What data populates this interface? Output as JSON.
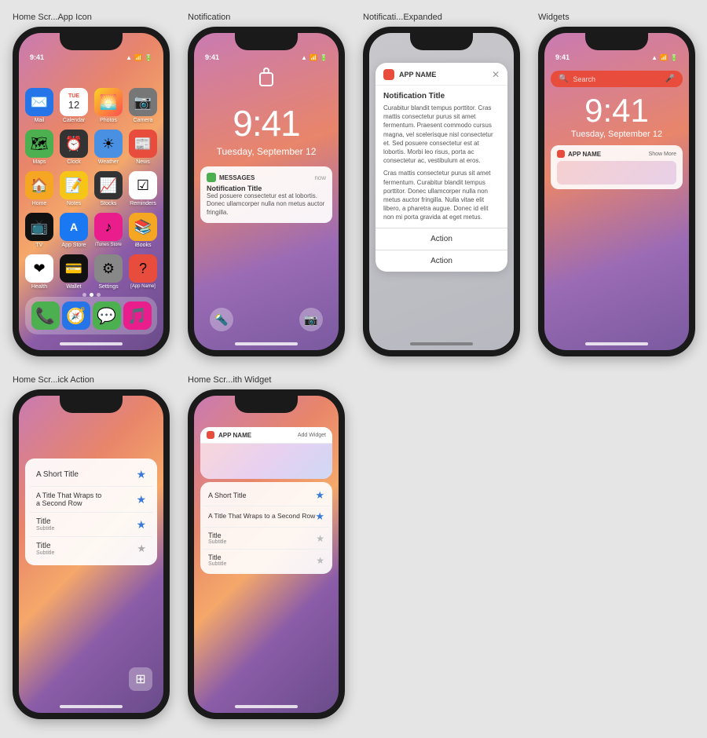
{
  "labels": {
    "homescreen": "Home Scr...App Icon",
    "notification": "Notification",
    "notif_expanded": "Notificati...Expanded",
    "widgets": "Widgets",
    "quick_action": "Home Scr...ick Action",
    "home_widget": "Home Scr...ith Widget"
  },
  "status": {
    "time": "9:41",
    "time_lock": "9:41",
    "signal": "●●●",
    "wifi": "WiFi",
    "battery": "■"
  },
  "lock_screen": {
    "time": "9:41",
    "date": "Tuesday, September 12",
    "notification": {
      "app": "MESSAGES",
      "time": "now",
      "title": "Notification Title",
      "body": "Sed posuere consectetur est at lobortis. Donec ullamcorper nulla non metus auctor fringilla."
    }
  },
  "notif_expanded": {
    "app_name": "APP NAME",
    "title": "Notification Title",
    "body": "Curabitur blandit tempus porttitor. Cras mattis consectetur purus sit amet fermentum. Praesent commodo cursus magna, vel scelerisque nisl consectetur et. Sed posuere consectetur est at lobortis. Morbi leo risus, porta ac consectetur ac, vestibulum at eros.\n\nCras mattis consectetur purus sit amet fermentum. Curabitur blandit tempus porttitor. Donec ullamcorper nulla non metus auctor fringilla. Nulla vitae elit libero, a pharetra augue. Donec id elit non mi porta gravida at eget metus.",
    "action1": "Action",
    "action2": "Action"
  },
  "widgets": {
    "search_placeholder": "Search",
    "time": "9:41",
    "date": "Tuesday, September 12",
    "app_name": "APP NAME",
    "show_more": "Show More"
  },
  "quick_action": {
    "items": [
      {
        "title": "A Short Title",
        "star_filled": true
      },
      {
        "title": "A Title That Wraps to a Second Row",
        "star_filled": true
      },
      {
        "title": "Title",
        "subtitle": "Subtitle",
        "star_filled": true
      },
      {
        "title": "Title",
        "subtitle": "Subtitle",
        "star_filled": false
      }
    ]
  },
  "home_widget": {
    "app_name": "APP NAME",
    "add_widget": "Add Widget",
    "items": [
      {
        "title": "A Short Title",
        "star_filled": true
      },
      {
        "title": "A Title That Wraps to a Second Row",
        "star_filled": true
      },
      {
        "title": "Title",
        "subtitle": "Subtitle",
        "star_filled": false
      },
      {
        "title": "Title",
        "subtitle": "Subtitle",
        "star_filled": false
      }
    ]
  },
  "apps": [
    {
      "name": "Mail",
      "bg": "#2575e8",
      "icon": "✉"
    },
    {
      "name": "Calendar",
      "bg": "#fff",
      "icon": "📅"
    },
    {
      "name": "Photos",
      "bg": "#f5c518",
      "icon": "🌅"
    },
    {
      "name": "Camera",
      "bg": "#555",
      "icon": "📷"
    },
    {
      "name": "Maps",
      "bg": "#4caf50",
      "icon": "🗺"
    },
    {
      "name": "Clock",
      "bg": "#333",
      "icon": "⏰"
    },
    {
      "name": "Weather",
      "bg": "#4a90e2",
      "icon": "☀"
    },
    {
      "name": "News",
      "bg": "#e74c3c",
      "icon": "📰"
    },
    {
      "name": "Home",
      "bg": "#f5a623",
      "icon": "🏠"
    },
    {
      "name": "Notes",
      "bg": "#f5c518",
      "icon": "📝"
    },
    {
      "name": "Stocks",
      "bg": "#333",
      "icon": "📈"
    },
    {
      "name": "Reminders",
      "bg": "#fff",
      "icon": "☑"
    },
    {
      "name": "TV",
      "bg": "#111",
      "icon": "📺"
    },
    {
      "name": "App Store",
      "bg": "#1a78f2",
      "icon": "A"
    },
    {
      "name": "iTunes Store",
      "bg": "#e91e8c",
      "icon": "♪"
    },
    {
      "name": "iBooks",
      "bg": "#f5a623",
      "icon": "📚"
    },
    {
      "name": "Health",
      "bg": "#fff",
      "icon": "❤"
    },
    {
      "name": "Wallet",
      "bg": "#111",
      "icon": "💳"
    },
    {
      "name": "Settings",
      "bg": "#888",
      "icon": "⚙"
    },
    {
      "name": "[App Name]",
      "bg": "#e74c3c",
      "icon": "?"
    }
  ]
}
